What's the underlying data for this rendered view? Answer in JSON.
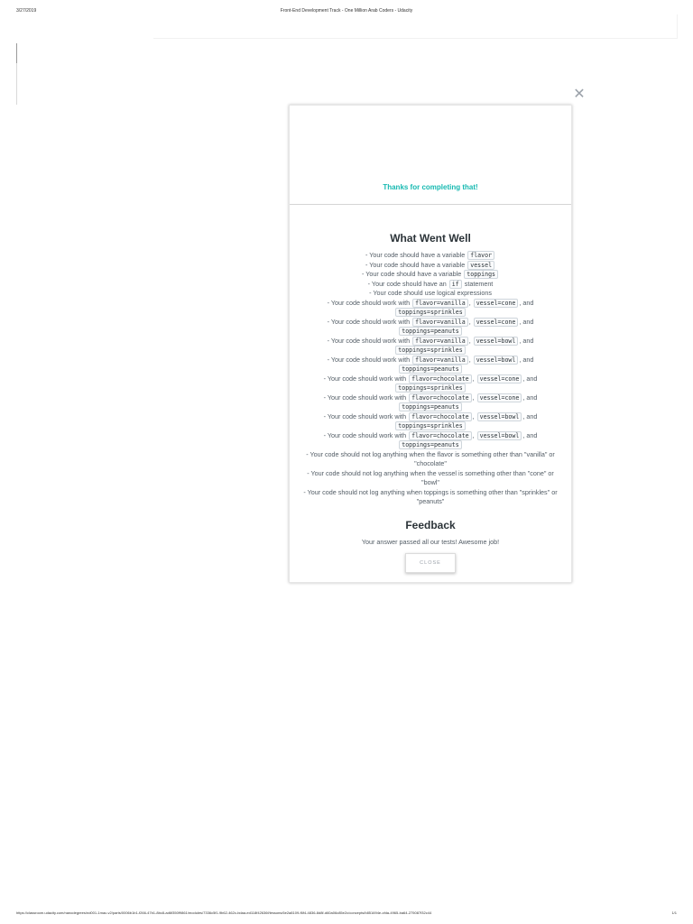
{
  "print": {
    "date": "3/27/2019",
    "page_title": "Front-End Development Track - One Million Arab Coders - Udacity",
    "url": "https://classroom.udacity.com/nanodegrees/nd001-1mac-v2/parts/0006b1b1-f266-47b1-8bc8-ad6f350f9861/modules/7336c5f1-9b62-462c-bdaa-ed118f42636f/lessons/6e2a8109-f6f4-4836-8d8f-d60a06c85e2c/concepts/b851694e-cfda-4965-ba64-275087f32c44",
    "pager": "1/1"
  },
  "icons": {
    "dismiss": "close-icon"
  },
  "modal": {
    "thanks": "Thanks for completing that!",
    "went_well_title": "What Went Well",
    "checks": [
      [
        "- Your code should have a variable ",
        {
          "code": "flavor"
        }
      ],
      [
        "- Your code should have a variable ",
        {
          "code": "vessel"
        }
      ],
      [
        "- Your code should have a variable ",
        {
          "code": "toppings"
        }
      ],
      [
        "- Your code should have an ",
        {
          "code": "if"
        },
        " statement"
      ],
      [
        "- Your code should use logical expressions"
      ],
      [
        "- Your code should work with ",
        {
          "code": "flavor=vanilla"
        },
        ", ",
        {
          "code": "vessel=cone"
        },
        ", and ",
        {
          "code": "toppings=sprinkles"
        }
      ],
      [
        "- Your code should work with ",
        {
          "code": "flavor=vanilla"
        },
        ", ",
        {
          "code": "vessel=cone"
        },
        ", and ",
        {
          "code": "toppings=peanuts"
        }
      ],
      [
        "- Your code should work with ",
        {
          "code": "flavor=vanilla"
        },
        ", ",
        {
          "code": "vessel=bowl"
        },
        ", and ",
        {
          "code": "toppings=sprinkles"
        }
      ],
      [
        "- Your code should work with ",
        {
          "code": "flavor=vanilla"
        },
        ", ",
        {
          "code": "vessel=bowl"
        },
        ", and ",
        {
          "code": "toppings=peanuts"
        }
      ],
      [
        "- Your code should work with ",
        {
          "code": "flavor=chocolate"
        },
        ", ",
        {
          "code": "vessel=cone"
        },
        ", and ",
        {
          "code": "toppings=sprinkles"
        }
      ],
      [
        "- Your code should work with ",
        {
          "code": "flavor=chocolate"
        },
        ", ",
        {
          "code": "vessel=cone"
        },
        ", and ",
        {
          "code": "toppings=peanuts"
        }
      ],
      [
        "- Your code should work with ",
        {
          "code": "flavor=chocolate"
        },
        ", ",
        {
          "code": "vessel=bowl"
        },
        ", and ",
        {
          "code": "toppings=sprinkles"
        }
      ],
      [
        "- Your code should work with ",
        {
          "code": "flavor=chocolate"
        },
        ", ",
        {
          "code": "vessel=bowl"
        },
        ", and ",
        {
          "code": "toppings=peanuts"
        }
      ],
      [
        "- Your code should not log anything when the flavor is something other than \"vanilla\" or \"chocolate\""
      ],
      [
        "- Your code should not log anything when the vessel is something other than \"cone\" or \"bowl\""
      ],
      [
        "- Your code should not log anything when toppings is something other than \"sprinkles\" or \"peanuts\""
      ]
    ],
    "feedback_title": "Feedback",
    "feedback_text": "Your answer passed all our tests! Awesome job!",
    "close_label": "CLOSE"
  }
}
